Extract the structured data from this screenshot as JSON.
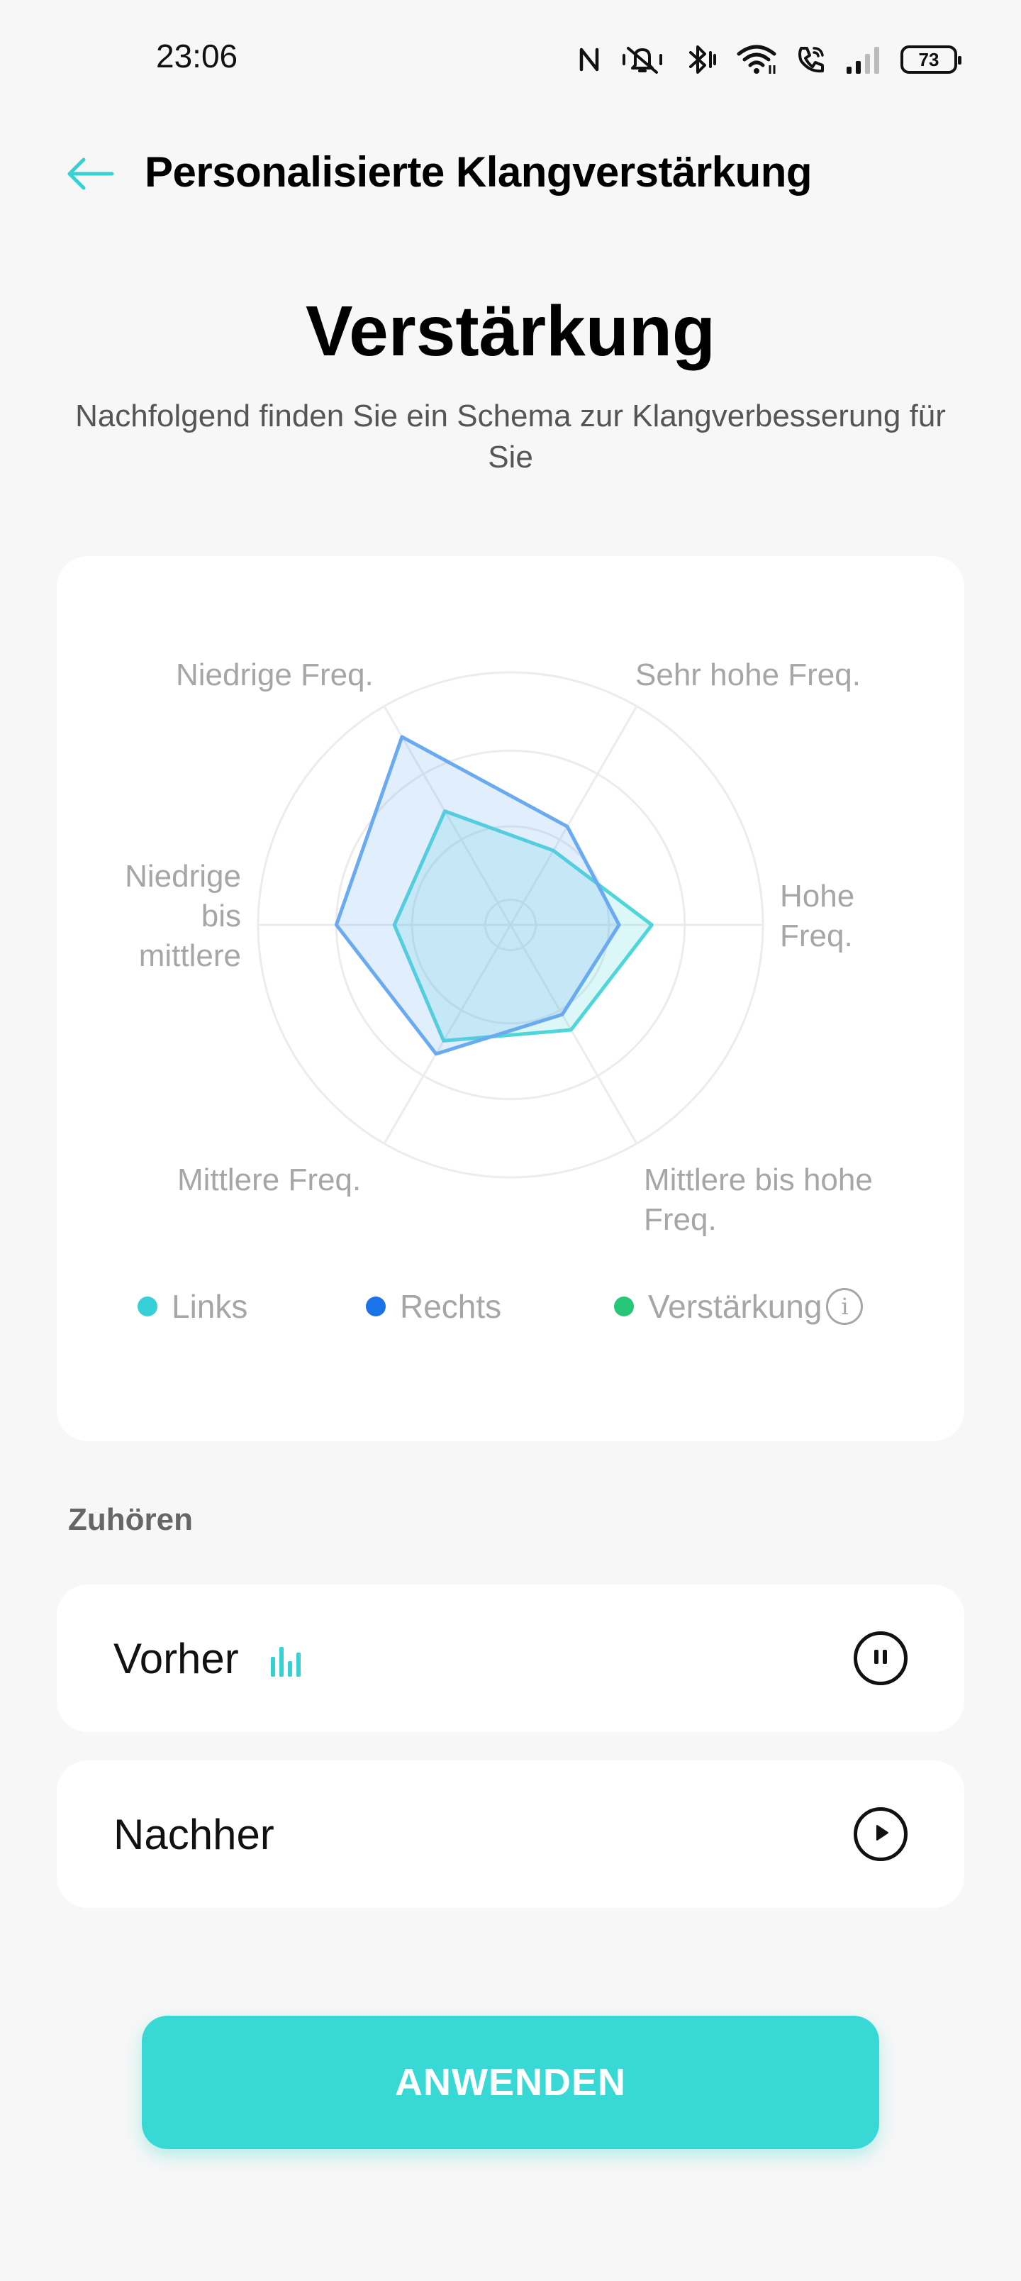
{
  "status_bar": {
    "time": "23:06",
    "battery": "73",
    "icons": [
      "nfc-icon",
      "vibrate-mute-icon",
      "bluetooth-icon",
      "wifi-icon",
      "wifi-calling-icon",
      "signal-icon",
      "battery-icon"
    ]
  },
  "header": {
    "title": "Personalisierte Klangverstärkung",
    "back_icon": "arrow-left-icon"
  },
  "hero": {
    "title": "Verstärkung",
    "subtitle": "Nachfolgend finden Sie ein Schema zur Klangverbesserung für Sie"
  },
  "chart_data": {
    "type": "radar",
    "axes": [
      "Sehr hohe Freq.",
      "Hohe Freq.",
      "Mittlere bis hohe Freq.",
      "Mittlere Freq.",
      "Niedrige bis mittlere",
      "Niedrige Freq."
    ],
    "axis_labels_display": {
      "sehr_hohe": "Sehr hohe Freq.",
      "hohe_line1": "Hohe",
      "hohe_line2": "Freq.",
      "mittlere_hohe_line1": "Mittlere bis hohe",
      "mittlere_hohe_line2": "Freq.",
      "mittlere": "Mittlere Freq.",
      "niedrige_mittlere_line1": "Niedrige",
      "niedrige_mittlere_line2": "bis",
      "niedrige_mittlere_line3": "mittlere",
      "niedrige": "Niedrige Freq."
    },
    "rings": 3,
    "range": [
      0,
      1
    ],
    "series": [
      {
        "name": "Links",
        "color": "#4fd6da",
        "values": [
          0.34,
          0.56,
          0.48,
          0.53,
          0.46,
          0.52
        ]
      },
      {
        "name": "Rechts",
        "color": "#6aaaf0",
        "values": [
          0.45,
          0.43,
          0.41,
          0.59,
          0.69,
          0.86
        ]
      }
    ],
    "legend": [
      {
        "label": "Links",
        "color": "#38d0d8"
      },
      {
        "label": "Rechts",
        "color": "#1a73e8"
      },
      {
        "label": "Verstärkung",
        "color": "#27c777",
        "info_icon": "info-icon"
      }
    ],
    "info_glyph": "i"
  },
  "listen": {
    "section_label": "Zuhören",
    "items": [
      {
        "label": "Vorher",
        "state": "playing",
        "indicator": "equalizer-bars-icon",
        "control": "pause-icon"
      },
      {
        "label": "Nachher",
        "state": "stopped",
        "control": "play-icon"
      }
    ]
  },
  "apply_button": {
    "label": "ANWENDEN"
  },
  "colors": {
    "accent": "#38d9d5",
    "background": "#f7f7f7",
    "card": "#ffffff"
  }
}
